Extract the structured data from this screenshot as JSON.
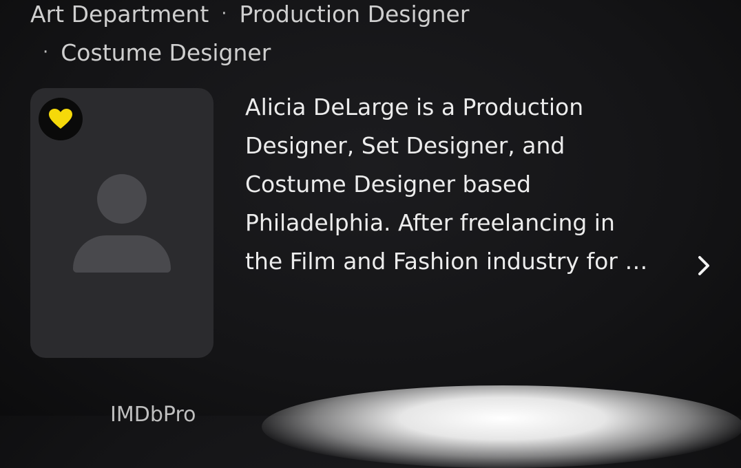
{
  "roles": {
    "items": [
      "Art Department",
      "Production Designer",
      "Costume Designer"
    ],
    "separator": "·"
  },
  "profile": {
    "favorite_icon": "heart-icon",
    "favorite_color": "#f5d90a",
    "avatar_icon": "person-placeholder-icon",
    "bio_lines": [
      "Alicia DeLarge is a Production",
      "Designer, Set Designer, and",
      "Costume Designer based",
      "Philadelphia. After freelancing in",
      "the Film and Fashion industry for …"
    ],
    "more_icon": "chevron-right-icon"
  },
  "footer": {
    "partial_label": "IMDbPro"
  }
}
